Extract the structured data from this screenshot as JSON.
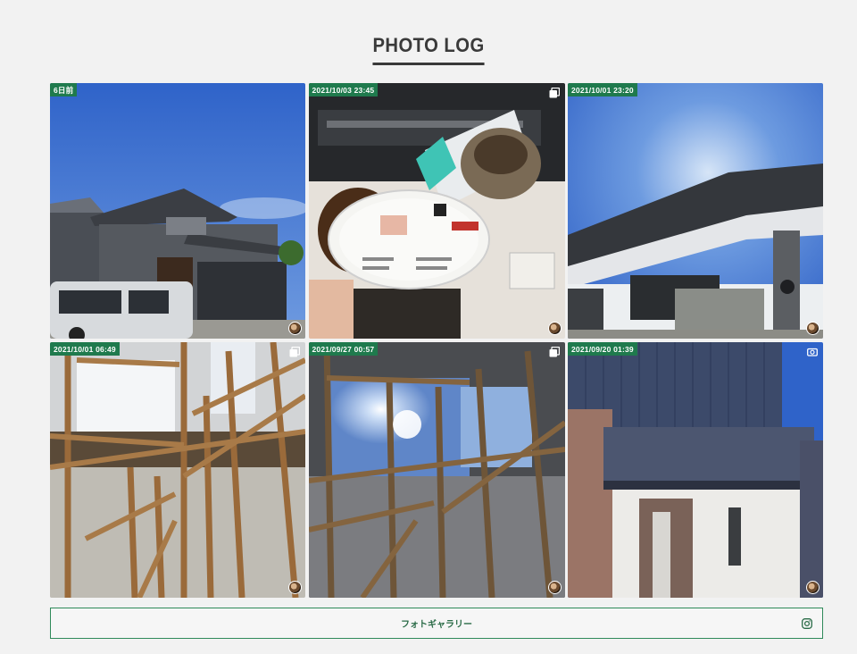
{
  "section": {
    "title": "PHOTO LOG"
  },
  "photos": [
    {
      "date": "6日前",
      "alt": "house exterior",
      "type_icon": ""
    },
    {
      "date": "2021/10/03 23:45",
      "alt": "coffee cup",
      "type_icon": "carousel-icon"
    },
    {
      "date": "2021/10/01 23:20",
      "alt": "house entrance",
      "type_icon": ""
    },
    {
      "date": "2021/10/01 06:49",
      "alt": "timber frame",
      "type_icon": "carousel-icon"
    },
    {
      "date": "2021/09/27 00:57",
      "alt": "timber frame skylight",
      "type_icon": "carousel-icon"
    },
    {
      "date": "2021/09/20 01:39",
      "alt": "entrance facade",
      "type_icon": "video-icon"
    }
  ],
  "gallery_button": {
    "label": "フォトギャラリー",
    "icon": "instagram-icon"
  },
  "colors": {
    "accent": "#1f7a4d",
    "border": "#2f8a5a",
    "background": "#f2f2f2"
  }
}
